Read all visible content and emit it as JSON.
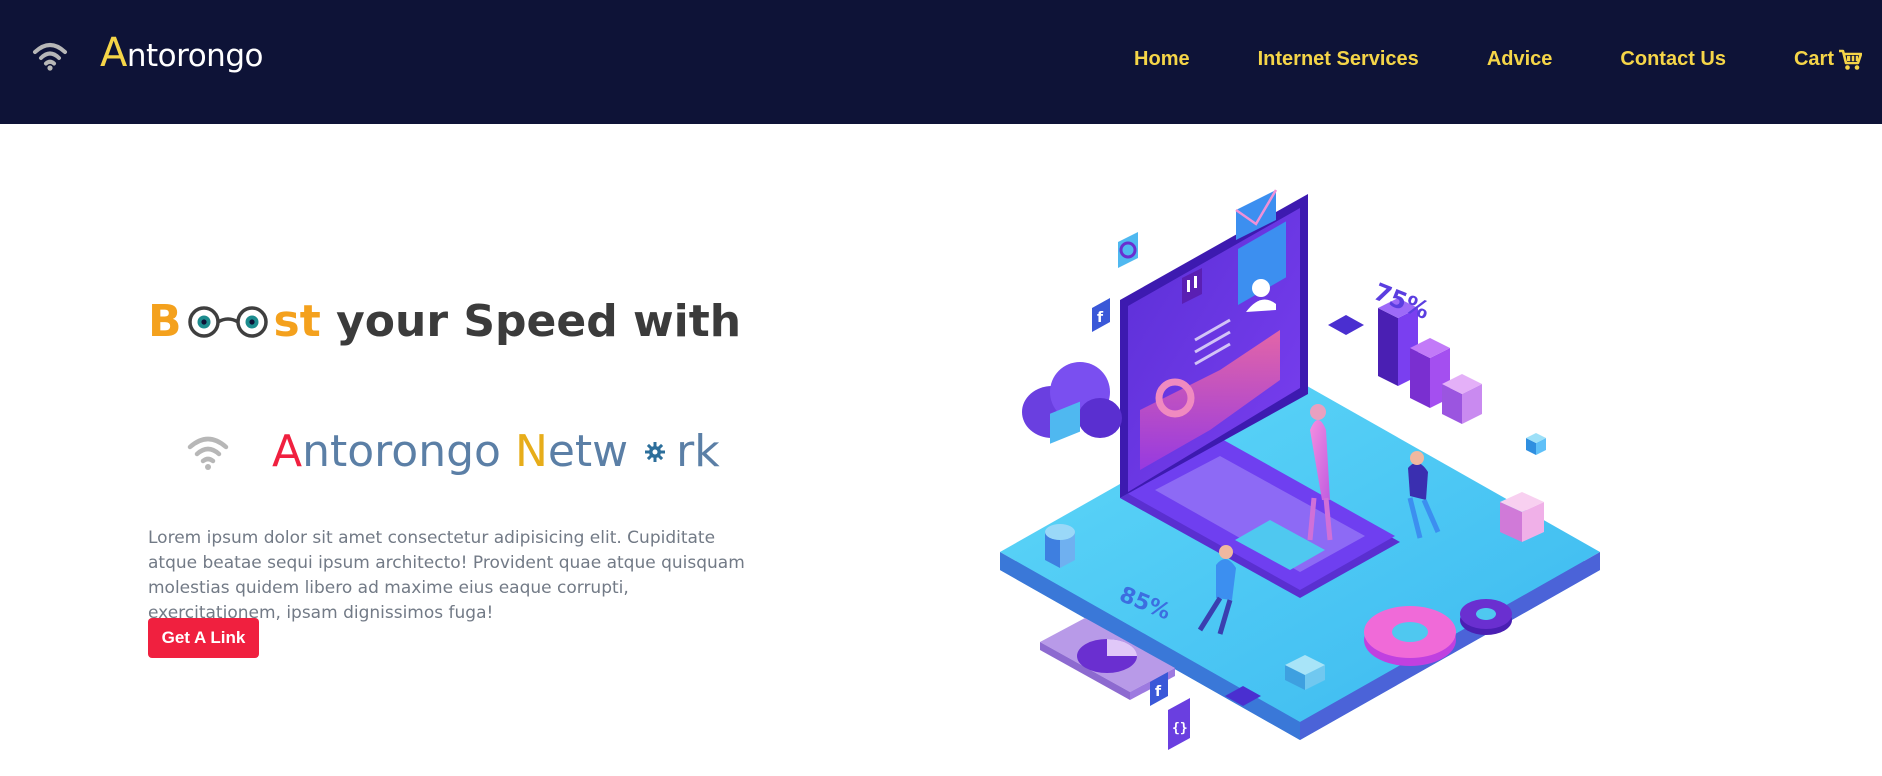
{
  "header": {
    "brand_cap": "A",
    "brand_rest": "ntorongo",
    "nav": [
      {
        "label": "Home"
      },
      {
        "label": "Internet Services"
      },
      {
        "label": "Advice"
      },
      {
        "label": "Contact Us"
      },
      {
        "label": "Cart"
      }
    ]
  },
  "hero": {
    "headline": {
      "b": "B",
      "st": "st",
      "rest": " your Speed with"
    },
    "network": {
      "a": "A",
      "ntorongo": "ntorongo ",
      "n": "N",
      "etw": "etw",
      "rk": "rk"
    },
    "body": "Lorem ipsum dolor sit amet consectetur adipisicing elit. Cupiditate atque beatae sequi ipsum architecto! Provident quae atque quisquam molestias quidem libero ad maxime eius eaque corrupti, exercitationem, ipsam dignissimos fuga!",
    "button": "Get A Link"
  },
  "illustration": {
    "stat_top": "75%",
    "stat_bottom": "85%"
  },
  "colors": {
    "nav_bg": "#0e1337",
    "nav_text": "#f5d548",
    "accent_red": "#f0203f",
    "accent_orange": "#f4a11d",
    "network_blue": "#5b7fa6"
  },
  "icons": [
    "wifi-icon",
    "cart-icon",
    "goggles-icon",
    "gear-icon"
  ]
}
